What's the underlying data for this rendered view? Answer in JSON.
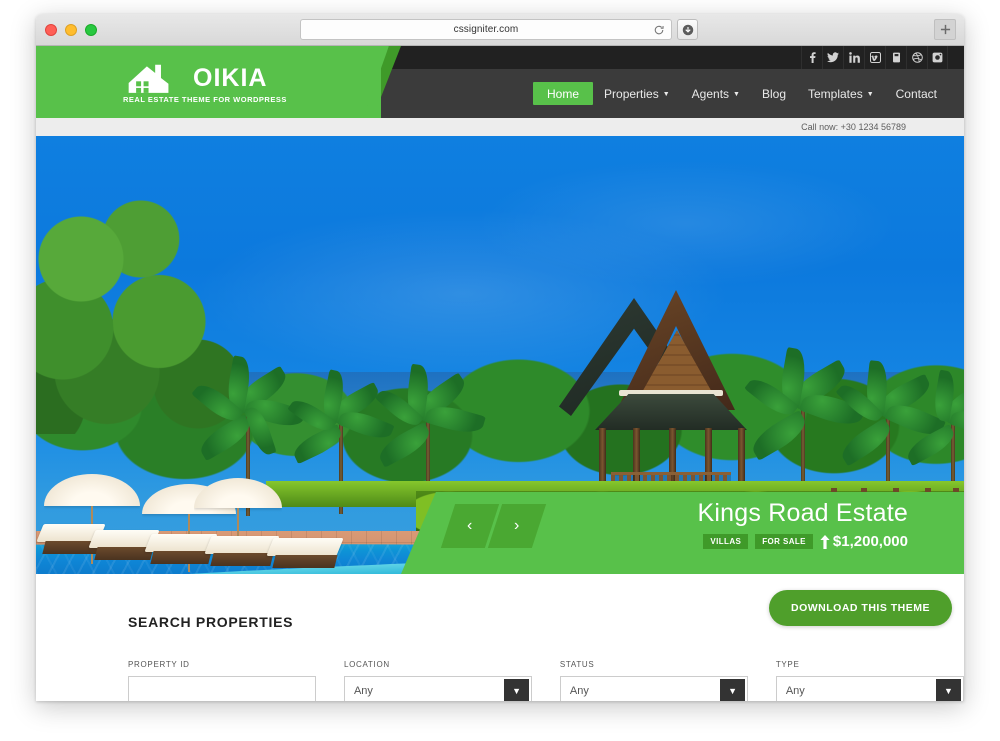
{
  "browser": {
    "url": "cssigniter.com",
    "reload_icon": "reload-icon",
    "download_icon": "download-icon",
    "new_tab_icon": "plus-icon",
    "traffic_lights": [
      "close",
      "minimize",
      "zoom"
    ]
  },
  "site": {
    "logo": {
      "name": "OIKIA",
      "tagline": "REAL ESTATE THEME FOR WORDPRESS",
      "icon": "house-icon"
    },
    "social": [
      {
        "name": "facebook-icon",
        "glyph": "f"
      },
      {
        "name": "twitter-icon",
        "glyph": "t"
      },
      {
        "name": "linkedin-icon",
        "glyph": "in"
      },
      {
        "name": "vimeo-icon",
        "glyph": "v"
      },
      {
        "name": "youtube-icon",
        "glyph": "y"
      },
      {
        "name": "dribbble-icon",
        "glyph": "d"
      },
      {
        "name": "instagram-icon",
        "glyph": "ig"
      }
    ],
    "nav": [
      {
        "label": "Home",
        "active": true,
        "caret": false
      },
      {
        "label": "Properties",
        "active": false,
        "caret": true
      },
      {
        "label": "Agents",
        "active": false,
        "caret": true
      },
      {
        "label": "Blog",
        "active": false,
        "caret": false
      },
      {
        "label": "Templates",
        "active": false,
        "caret": true
      },
      {
        "label": "Contact",
        "active": false,
        "caret": false
      }
    ],
    "call_bar": "Call now: +30 1234 56789"
  },
  "hero": {
    "slide_title": "Kings Road Estate",
    "badges": [
      "VILLAS",
      "FOR SALE"
    ],
    "price": "$1,200,000",
    "price_icon": "tag-icon",
    "prev_label": "‹",
    "next_label": "›",
    "image_alt": "tropical-resort-pool-pavilion"
  },
  "search": {
    "title": "SEARCH PROPERTIES",
    "fields": [
      {
        "label": "PROPERTY ID",
        "value": "",
        "placeholder": "",
        "type": "text"
      },
      {
        "label": "LOCATION",
        "value": "Any",
        "type": "select"
      },
      {
        "label": "STATUS",
        "value": "Any",
        "type": "select"
      },
      {
        "label": "TYPE",
        "value": "Any",
        "type": "select"
      }
    ]
  },
  "floating": {
    "download_label": "DOWNLOAD THIS THEME"
  },
  "colors": {
    "brand_green": "#58c14a",
    "dark_green": "#3f9a29",
    "button_green": "#4f9f2b",
    "nav_dark": "#3b3b3b",
    "topbar_dark": "#212121"
  }
}
